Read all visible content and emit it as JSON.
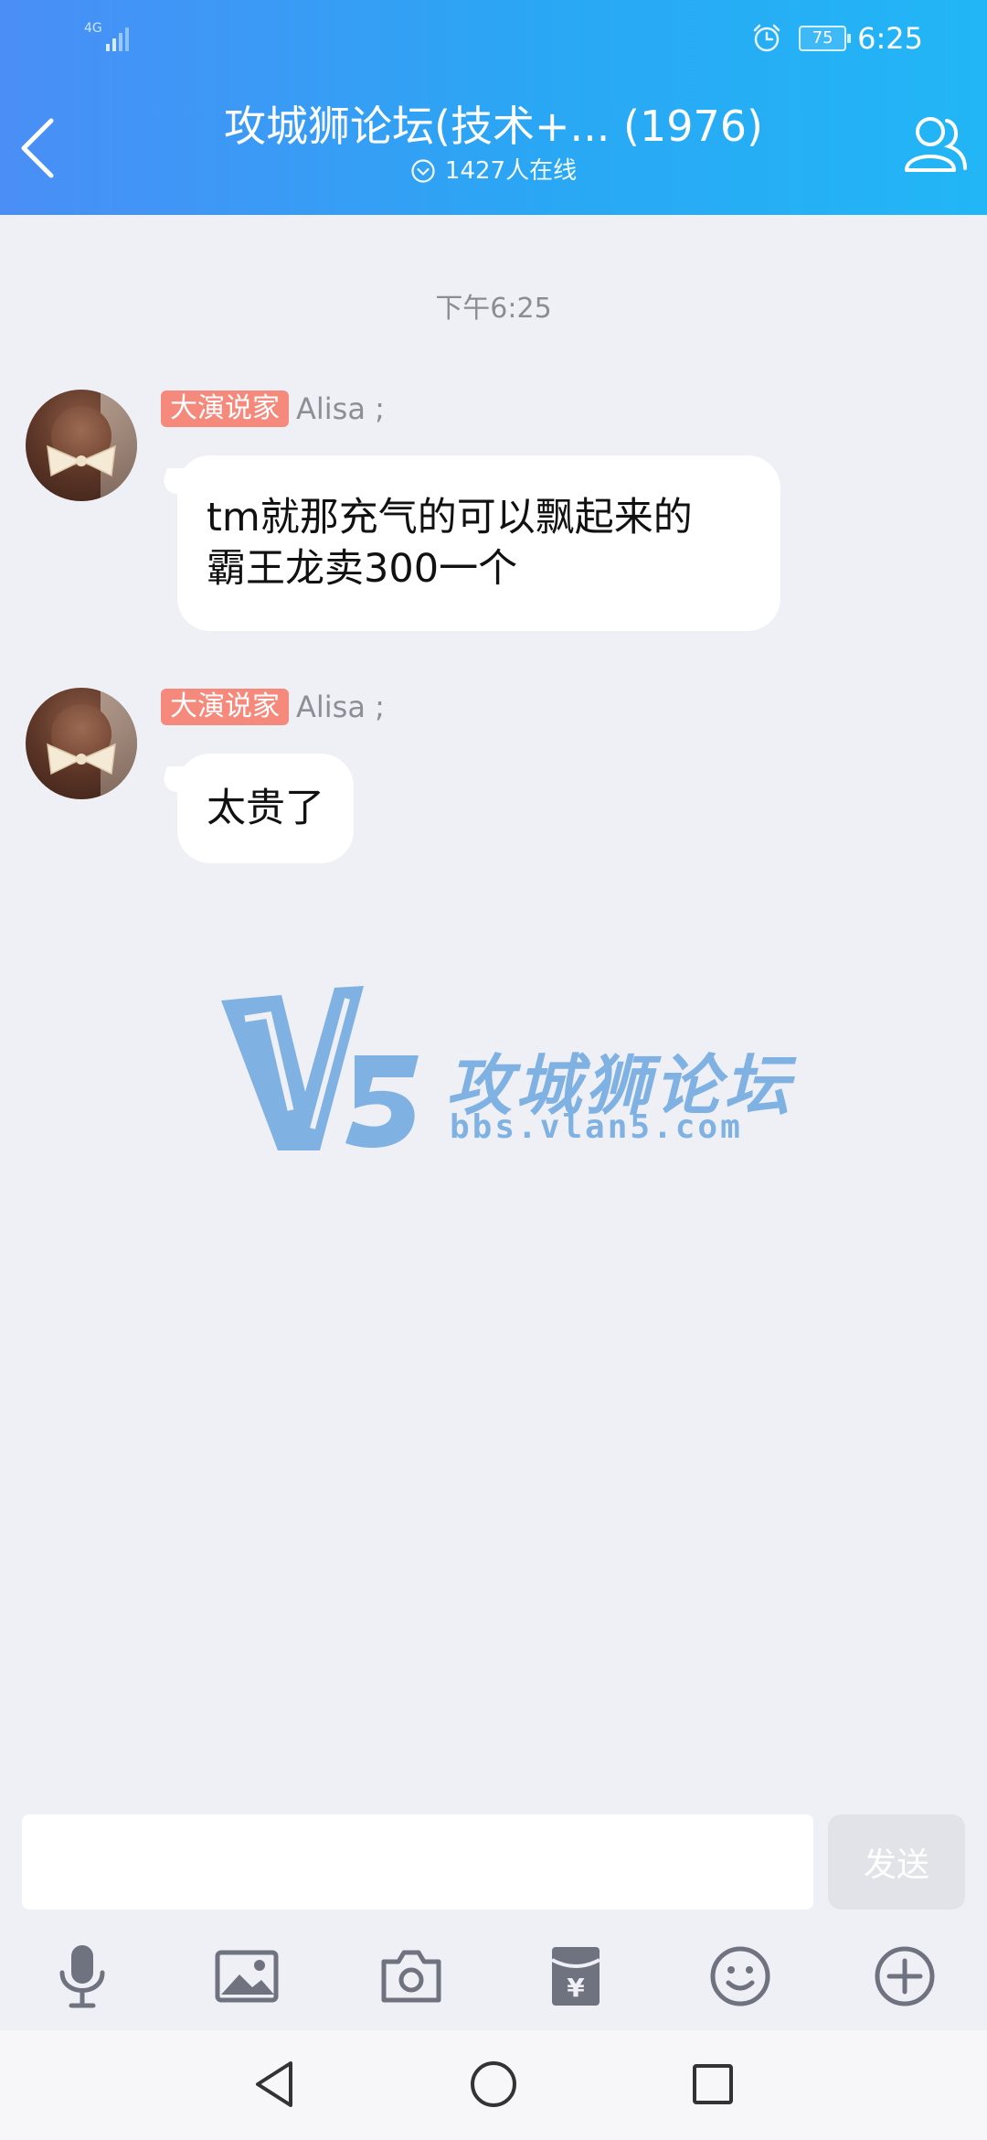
{
  "status_bar": {
    "network": "4G",
    "battery": "75",
    "time": "6:25"
  },
  "header": {
    "title": "攻城狮论坛(技术+... (1976)",
    "online_count": "1427人在线"
  },
  "chat": {
    "timestamp": "下午6:25",
    "messages": [
      {
        "tag": "大演说家",
        "nickname": "Alisa ;",
        "text_lines": [
          "tm就那充气的可以飘起来的",
          "霸王龙卖300一个"
        ]
      },
      {
        "tag": "大演说家",
        "nickname": "Alisa ;",
        "text_lines": [
          "太贵了"
        ]
      }
    ]
  },
  "watermark": {
    "logo_text": "V5",
    "name": "攻城狮论坛",
    "url": "bbs.vlan5.com"
  },
  "input": {
    "value": "",
    "placeholder": "",
    "send_label": "发送"
  },
  "toolbar": {
    "icons": [
      "microphone-icon",
      "image-icon",
      "camera-icon",
      "red-packet-icon",
      "emoji-icon",
      "plus-icon"
    ]
  },
  "nav": {
    "icons": [
      "nav-back-icon",
      "nav-home-icon",
      "nav-recents-icon"
    ]
  },
  "colors": {
    "header_start": "#4a8ef6",
    "header_end": "#22b6f6",
    "tag_bg": "#f5897c",
    "chat_bg": "#eff0f6",
    "watermark": "#7fb2e2"
  }
}
